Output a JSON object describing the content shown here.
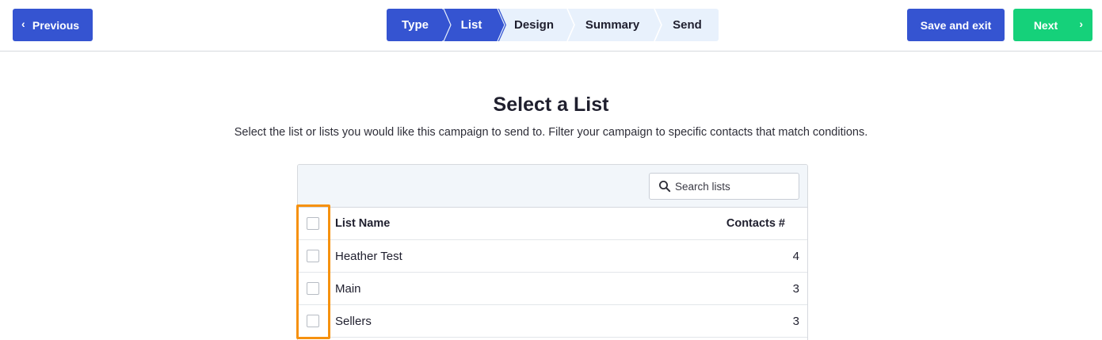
{
  "toolbar": {
    "previous_label": "Previous",
    "save_label": "Save and exit",
    "next_label": "Next"
  },
  "stepper": {
    "steps": [
      {
        "label": "Type",
        "state": "complete"
      },
      {
        "label": "List",
        "state": "active"
      },
      {
        "label": "Design",
        "state": "pending"
      },
      {
        "label": "Summary",
        "state": "pending"
      },
      {
        "label": "Send",
        "state": "pending"
      }
    ]
  },
  "main": {
    "title": "Select a List",
    "subtitle": "Select the list or lists you would like this campaign to send to. Filter your campaign to specific contacts that match conditions."
  },
  "search": {
    "placeholder": "Search lists",
    "value": ""
  },
  "table": {
    "columns": [
      "List Name",
      "Contacts #"
    ],
    "rows": [
      {
        "name": "Heather Test",
        "contacts": "4",
        "checked": false
      },
      {
        "name": "Main",
        "contacts": "3",
        "checked": false
      },
      {
        "name": "Sellers",
        "contacts": "3",
        "checked": false
      }
    ]
  },
  "icons": {
    "previous": "chevron-left-icon",
    "next": "chevron-right-icon",
    "search": "search-icon"
  },
  "colors": {
    "primary": "#3554d1",
    "success": "#15d17a",
    "stepper_bg": "#e8f1fc",
    "highlight": "#f6910f"
  }
}
